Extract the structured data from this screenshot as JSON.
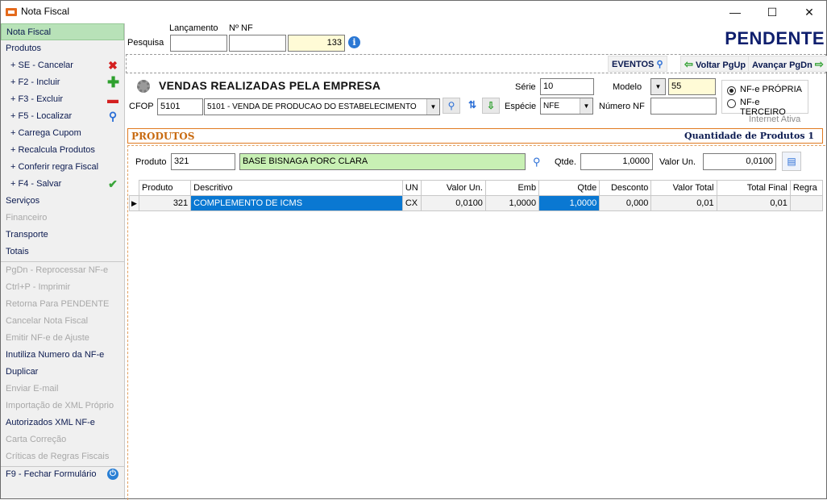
{
  "window": {
    "title": "Nota Fiscal"
  },
  "sidebar": {
    "items": [
      {
        "label": "Nota Fiscal"
      },
      {
        "label": "Produtos"
      },
      {
        "label": "+ SE - Cancelar"
      },
      {
        "label": "+ F2 - Incluir"
      },
      {
        "label": "+ F3 - Excluir"
      },
      {
        "label": "+ F5 - Localizar"
      },
      {
        "label": "+ Carrega Cupom"
      },
      {
        "label": "+ Recalcula Produtos"
      },
      {
        "label": "+ Conferir regra Fiscal"
      },
      {
        "label": "+ F4 - Salvar"
      },
      {
        "label": "Serviços"
      },
      {
        "label": "Financeiro"
      },
      {
        "label": "Transporte"
      },
      {
        "label": "Totais"
      },
      {
        "label": "PgDn - Reprocessar NF-e"
      },
      {
        "label": "Ctrl+P - Imprimir"
      },
      {
        "label": "Retorna Para PENDENTE"
      },
      {
        "label": "Cancelar Nota Fiscal"
      },
      {
        "label": "Emitir NF-e de Ajuste"
      },
      {
        "label": "Inutiliza Numero da NF-e"
      },
      {
        "label": "Duplicar"
      },
      {
        "label": "Enviar E-mail"
      },
      {
        "label": "Importação de XML Próprio"
      },
      {
        "label": "Autorizados XML NF-e"
      },
      {
        "label": "Carta Correção"
      },
      {
        "label": "Críticas de Regras Fiscais"
      },
      {
        "label": "F9 - Fechar Formulário"
      }
    ]
  },
  "header": {
    "pesquisa_label": "Pesquisa",
    "lancamento_label": "Lançamento",
    "nnf_label": "Nº NF",
    "lancamento_value": "",
    "nnf_value": "",
    "pesquisa_value": "133",
    "status": "PENDENTE",
    "status_color": "#0f1f6e"
  },
  "events": {
    "eventos_label": "EVENTOS",
    "voltar_label": "Voltar PgUp",
    "avancar_label": "Avançar PgDn"
  },
  "form": {
    "heading": "VENDAS REALIZADAS PELA EMPRESA",
    "cfop_label": "CFOP",
    "cfop_code": "5101",
    "cfop_desc": "5101 - VENDA DE PRODUCAO DO ESTABELECIMENTO",
    "serie_label": "Série",
    "serie_value": "10",
    "modelo_label": "Modelo",
    "modelo_value": "55",
    "especie_label": "Espécie",
    "especie_value": "NFE",
    "numero_nf_label": "Número NF",
    "numero_nf_value": "",
    "radio_propria": "NF-e PRÓPRIA",
    "radio_terceiro": "NF-e TERCEIRO",
    "internet_status": "Internet Ativa"
  },
  "produtos": {
    "title": "PRODUTOS",
    "count_label": "Quantidade de Produtos 1",
    "produto_label": "Produto",
    "produto_code": "321",
    "produto_desc": "BASE BISNAGA PORC CLARA",
    "qtde_label": "Qtde.",
    "qtde_value": "1,0000",
    "valor_un_label": "Valor Un.",
    "valor_un_value": "0,0100"
  },
  "grid": {
    "columns": [
      "Produto",
      "Descritivo",
      "UN",
      "Valor Un.",
      "Emb",
      "Qtde",
      "Desconto",
      "Valor Total",
      "Total Final",
      "Regra"
    ],
    "rows": [
      {
        "produto": "321",
        "descritivo": "COMPLEMENTO DE ICMS",
        "un": "CX",
        "valor_un": "0,0100",
        "emb": "1,0000",
        "qtde": "1,0000",
        "desconto": "0,000",
        "valor_total": "0,01",
        "total_final": "0,01",
        "regra": ""
      }
    ]
  },
  "colors": {
    "selected_nav": "#b8e2b8",
    "selection": "#0a78d2",
    "accent_orange": "#c86a10"
  }
}
